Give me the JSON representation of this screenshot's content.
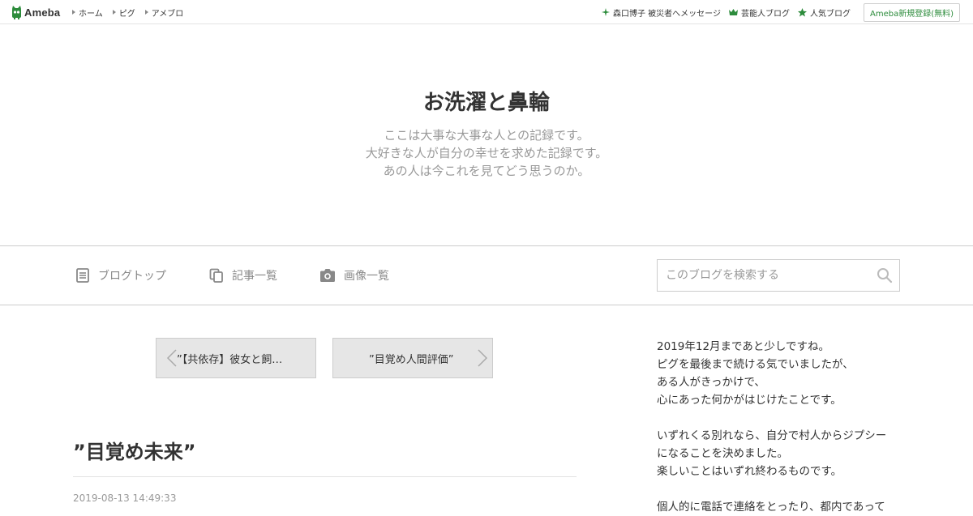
{
  "global_header": {
    "logo_text": "Ameba",
    "nav": [
      "ホーム",
      "ピグ",
      "アメブロ"
    ],
    "right_links": [
      {
        "label": "森口博子 被災者へメッセージ",
        "icon": "sparkle-icon"
      },
      {
        "label": "芸能人ブログ",
        "icon": "crown-icon"
      },
      {
        "label": "人気ブログ",
        "icon": "star-icon"
      }
    ],
    "register_label": "Ameba新規登録(無料)",
    "accent_color": "#2d8c3c"
  },
  "blog_header": {
    "title": "お洗濯と鼻輪",
    "description": [
      "ここは大事な大事な人との記録です。",
      "大好きな人が自分の幸せを求めた記録です。",
      "あの人は今これを見てどう思うのか。"
    ]
  },
  "blog_nav": {
    "items": [
      {
        "label": "ブログトップ",
        "icon": "document-icon"
      },
      {
        "label": "記事一覧",
        "icon": "copy-icon"
      },
      {
        "label": "画像一覧",
        "icon": "camera-icon"
      }
    ],
    "search_placeholder": "このブログを検索する"
  },
  "pager": {
    "prev_label": "”【共依存】彼女と飼…",
    "next_label": "”目覚め人間評価”"
  },
  "article": {
    "title": "”目覚め未来”",
    "date": "2019-08-13 14:49:33"
  },
  "sidebar": {
    "paragraphs": [
      [
        "2019年12月まであと少しですね。",
        "ピグを最後まで続ける気でいましたが、",
        "ある人がきっかけで、",
        "心にあった何かがはじけたことです。"
      ],
      [
        "いずれくる別れなら、自分で村人からジプシー",
        "になることを決めました。",
        "楽しいことはいずれ終わるものです。"
      ],
      [
        "個人的に電話で連絡をとったり、都内であって"
      ]
    ]
  }
}
